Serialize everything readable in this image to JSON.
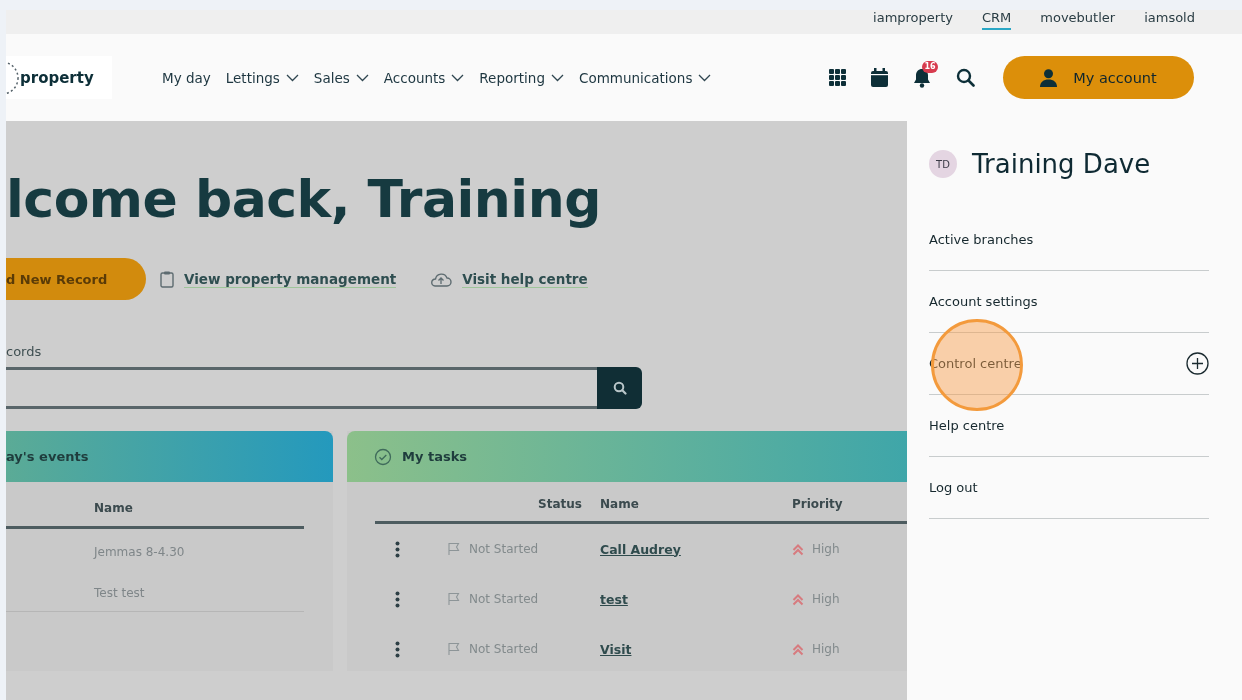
{
  "topbar_links": [
    {
      "label": "iamproperty",
      "selected": false
    },
    {
      "label": "CRM",
      "selected": true
    },
    {
      "label": "movebutler",
      "selected": false
    },
    {
      "label": "iamsold",
      "selected": false
    }
  ],
  "logo": {
    "text": "property"
  },
  "nav": [
    {
      "label": "My day",
      "dropdown": false
    },
    {
      "label": "Lettings",
      "dropdown": true
    },
    {
      "label": "Sales",
      "dropdown": true
    },
    {
      "label": "Accounts",
      "dropdown": true
    },
    {
      "label": "Reporting",
      "dropdown": true
    },
    {
      "label": "Communications",
      "dropdown": true
    }
  ],
  "notifications": {
    "count": "16"
  },
  "account_button": {
    "label": "My account"
  },
  "page": {
    "heading": "lcome back, Training",
    "primary_button": "d New Record",
    "links": [
      "View property management",
      "Visit help centre"
    ],
    "search_label": "cords"
  },
  "events_panel": {
    "title": "ay's events",
    "columns": [
      "Name"
    ],
    "rows": [
      [
        "Jemmas 8-4.30"
      ],
      [
        "Test test"
      ]
    ]
  },
  "tasks_panel": {
    "title": "My tasks",
    "columns": [
      "Status",
      "Name",
      "Priority"
    ],
    "rows": [
      {
        "status": "Not Started",
        "name": "Call Audrey",
        "priority": "High"
      },
      {
        "status": "Not Started",
        "name": "test",
        "priority": "High"
      },
      {
        "status": "Not Started",
        "name": "Visit",
        "priority": "High"
      }
    ]
  },
  "account_menu": {
    "initials": "TD",
    "name": "Training Dave",
    "items": [
      {
        "label": "Active branches",
        "expandable": false
      },
      {
        "label": "Account settings",
        "expandable": false
      },
      {
        "label": "Control centre",
        "expandable": true
      },
      {
        "label": "Help centre",
        "expandable": false
      },
      {
        "label": "Log out",
        "expandable": false
      }
    ]
  }
}
